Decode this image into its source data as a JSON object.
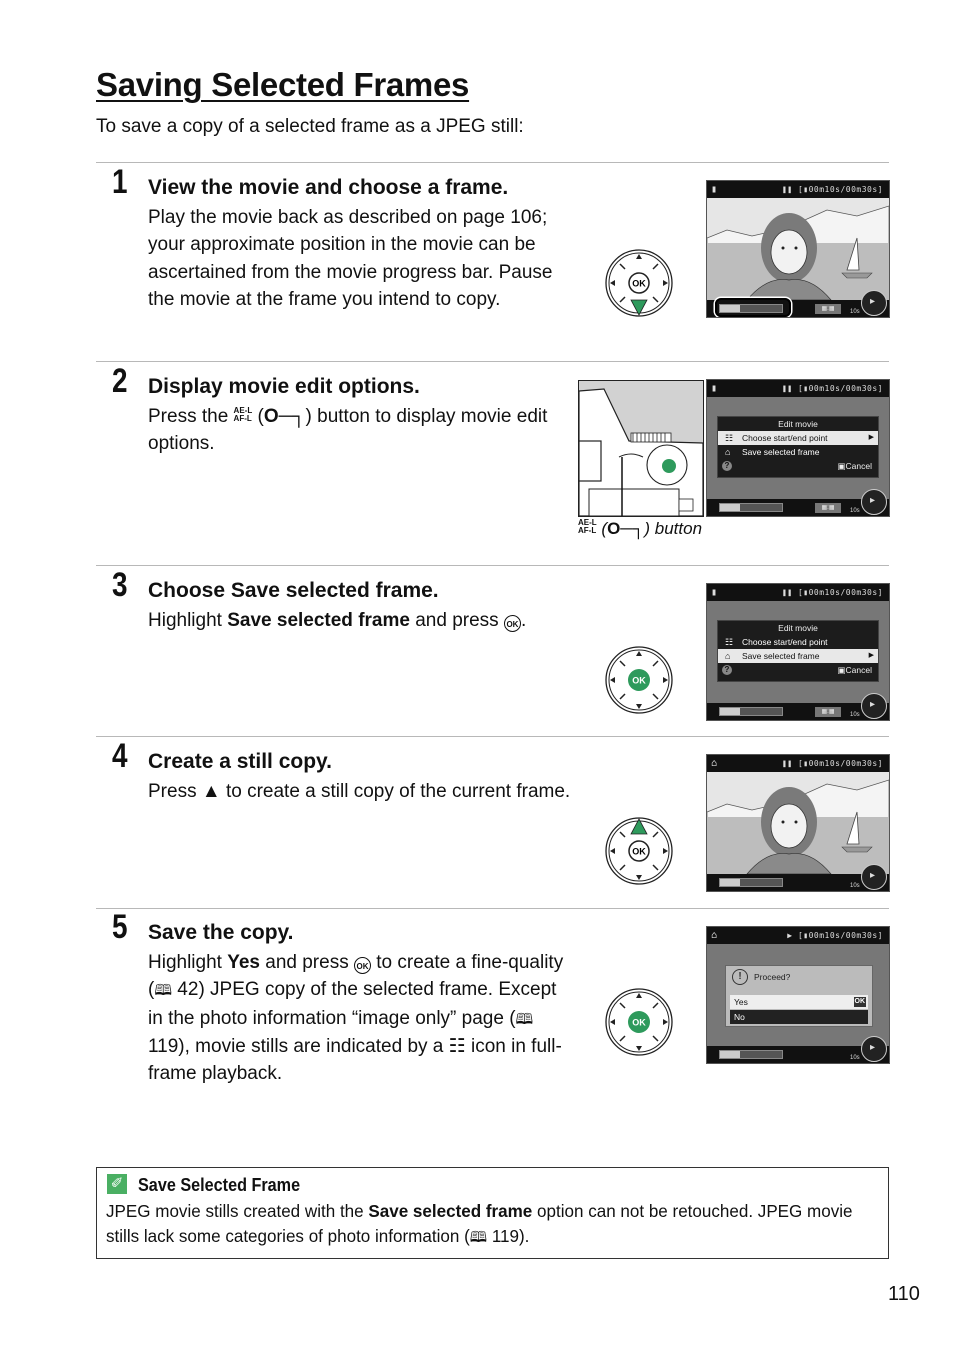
{
  "page": {
    "title": "Saving Selected Frames",
    "intro": "To save a copy of a selected frame as a JPEG still:",
    "page_number": "110"
  },
  "steps": [
    {
      "number": "1",
      "heading": "View the movie and choose a frame.",
      "body": "Play the movie back as described on page 106; your approximate position in the movie can be ascertained from the movie progress bar.  Pause the movie at the frame you intend to copy.",
      "selector_highlight": "down"
    },
    {
      "number": "2",
      "heading": "Display movie edit options.",
      "body_before": "Press the ",
      "button_glyph_top": "AE-L",
      "button_glyph_bottom": "AF-L",
      "key_glyph": "O─┐",
      "body_after": " button to display movie edit options.",
      "camera_callout_suffix": " button"
    },
    {
      "number": "3",
      "heading_prefix": "Choose ",
      "heading_bold": "Save selected frame.",
      "body_before": "Highlight ",
      "body_bold": "Save selected frame",
      "body_after": " and press ",
      "ok_glyph": "OK",
      "body_end": ".",
      "selector_highlight": "ok"
    },
    {
      "number": "4",
      "heading": "Create a still copy.",
      "body_before": "Press ",
      "body_glyph": "▲",
      "body_after": " to create a still copy of the current frame.",
      "selector_highlight": "up"
    },
    {
      "number": "5",
      "heading": "Save the copy.",
      "body_1": "Highlight ",
      "body_bold": "Yes",
      "body_2": " and press ",
      "ok_glyph": "OK",
      "body_3": " to create a fine-quality (",
      "ref_1": "42",
      "body_4": ") JPEG copy of the selected frame.  Except in the photo information “image only” page (",
      "ref_2": "119",
      "body_5": "), movie stills are indicated by a ",
      "icon_glyph": "☷",
      "body_6": " icon in full-frame playback.",
      "selector_highlight": "ok"
    }
  ],
  "screens": {
    "time_readout": "[▮00m10s/00m30s]",
    "pause_icon": "❚❚",
    "play_icon": "▶",
    "progress_fraction": 0.33,
    "display_icons": "▦:▦",
    "volume_label": "10s",
    "edit_menu": {
      "title": "Edit movie",
      "items": [
        {
          "icon": "☷",
          "label": "Choose start/end point"
        },
        {
          "icon": "⌂",
          "label": "Save selected frame"
        }
      ],
      "help": "?",
      "cancel_icon": "▣",
      "cancel": "Cancel"
    },
    "confirm_dialog": {
      "question": "Proceed?",
      "warning_glyph": "!",
      "yes": "Yes",
      "no": "No",
      "ok_badge": "OK"
    }
  },
  "multi_selector": {
    "ok_label": "OK",
    "active_color": "#2e9a5c"
  },
  "note": {
    "icon": "✐",
    "heading": "Save Selected Frame",
    "body_1": "JPEG movie stills created with the ",
    "body_bold": "Save selected frame",
    "body_2": " option can not be retouched.  JPEG movie stills lack some categories of photo information (",
    "ref": "119",
    "body_3": ")."
  },
  "glyphs": {
    "book": "🕮"
  }
}
